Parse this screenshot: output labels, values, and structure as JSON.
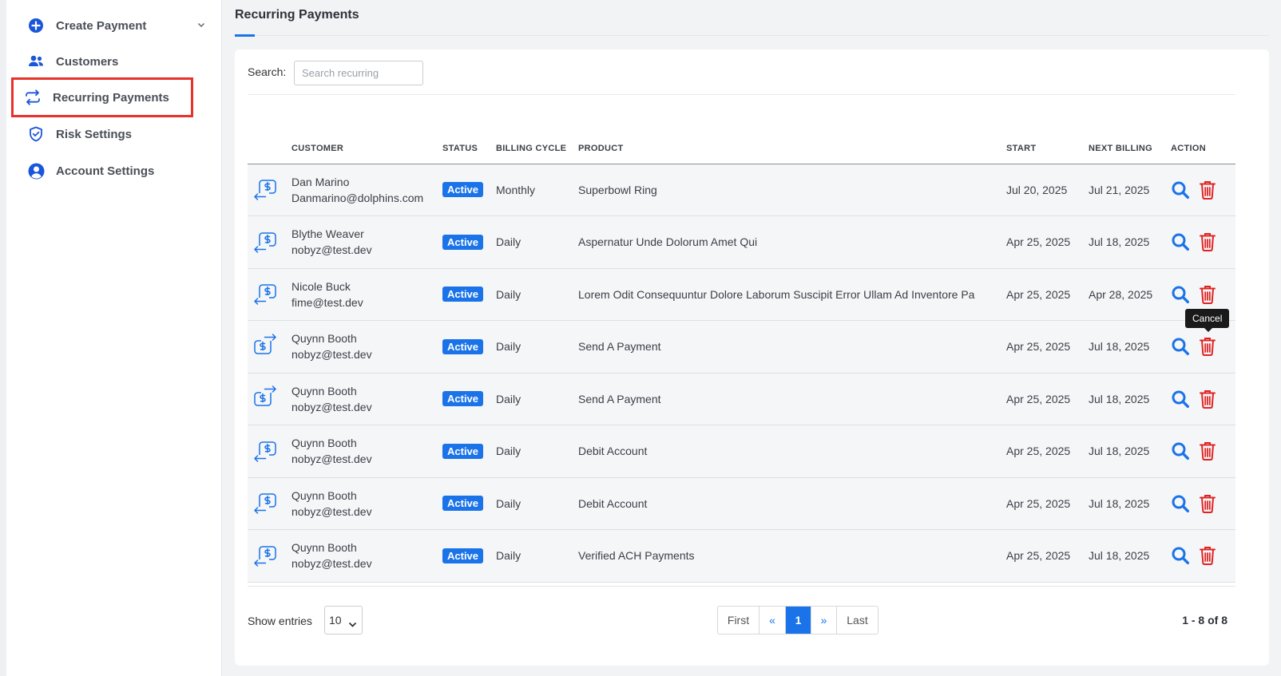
{
  "sidebar": {
    "items": [
      {
        "label": "Create Payment",
        "icon": "plus-circle-icon"
      },
      {
        "label": "Customers",
        "icon": "users-icon"
      },
      {
        "label": "Recurring Payments",
        "icon": "recurring-arrows-icon"
      },
      {
        "label": "Risk Settings",
        "icon": "shield-check-icon"
      },
      {
        "label": "Account Settings",
        "icon": "user-circle-icon"
      }
    ],
    "highlighted": "Recurring Payments",
    "highlight_color": "#e6332a"
  },
  "page": {
    "title": "Recurring Payments"
  },
  "search": {
    "label": "Search:",
    "placeholder": "Search recurring",
    "value": ""
  },
  "table": {
    "columns": [
      "CUSTOMER",
      "STATUS",
      "BILLING CYCLE",
      "PRODUCT",
      "START",
      "NEXT BILLING",
      "ACTION"
    ],
    "rows": [
      {
        "icon": "incoming",
        "name": "Dan Marino",
        "email": "Danmarino@dolphins.com",
        "status": "Active",
        "cycle": "Monthly",
        "product": "Superbowl Ring",
        "start": "Jul 20, 2025",
        "next": "Jul 21, 2025"
      },
      {
        "icon": "incoming",
        "name": "Blythe Weaver",
        "email": "nobyz@test.dev",
        "status": "Active",
        "cycle": "Daily",
        "product": "Aspernatur Unde Dolorum Amet Qui",
        "start": "Apr 25, 2025",
        "next": "Jul 18, 2025"
      },
      {
        "icon": "incoming",
        "name": "Nicole Buck",
        "email": "fime@test.dev",
        "status": "Active",
        "cycle": "Daily",
        "product": "Lorem Odit Consequuntur Dolore Laborum Suscipit Error Ullam Ad Inventore Pa",
        "start": "Apr 25, 2025",
        "next": "Apr 28, 2025"
      },
      {
        "icon": "outgoing",
        "name": "Quynn Booth",
        "email": "nobyz@test.dev",
        "status": "Active",
        "cycle": "Daily",
        "product": "Send A Payment",
        "start": "Apr 25, 2025",
        "next": "Jul 18, 2025"
      },
      {
        "icon": "outgoing",
        "name": "Quynn Booth",
        "email": "nobyz@test.dev",
        "status": "Active",
        "cycle": "Daily",
        "product": "Send A Payment",
        "start": "Apr 25, 2025",
        "next": "Jul 18, 2025"
      },
      {
        "icon": "incoming",
        "name": "Quynn Booth",
        "email": "nobyz@test.dev",
        "status": "Active",
        "cycle": "Daily",
        "product": "Debit Account",
        "start": "Apr 25, 2025",
        "next": "Jul 18, 2025"
      },
      {
        "icon": "incoming",
        "name": "Quynn Booth",
        "email": "nobyz@test.dev",
        "status": "Active",
        "cycle": "Daily",
        "product": "Debit Account",
        "start": "Apr 25, 2025",
        "next": "Jul 18, 2025"
      },
      {
        "icon": "incoming",
        "name": "Quynn Booth",
        "email": "nobyz@test.dev",
        "status": "Active",
        "cycle": "Daily",
        "product": "Verified ACH Payments",
        "start": "Apr 25, 2025",
        "next": "Jul 18, 2025"
      }
    ],
    "actions": {
      "view_icon": "search-icon",
      "delete_icon": "trash-icon"
    }
  },
  "tooltip": {
    "text": "Cancel"
  },
  "footer": {
    "show_entries_label": "Show entries",
    "entries_value": "10",
    "pagination": {
      "first": "First",
      "prev": "«",
      "current": "1",
      "next": "»",
      "last": "Last"
    },
    "count_text": "1 - 8 of 8"
  },
  "colors": {
    "accent": "#1a73e8",
    "danger": "#e02424",
    "badge": "#1a73e8"
  }
}
